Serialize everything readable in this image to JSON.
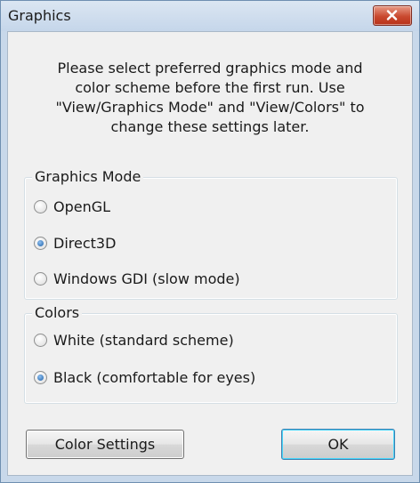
{
  "window": {
    "title": "Graphics"
  },
  "message": {
    "lines": [
      "Please select preferred graphics mode and",
      "color scheme before the first run. Use",
      "\"View/Graphics Mode\" and \"View/Colors\" to",
      "change these settings later."
    ]
  },
  "graphics_mode": {
    "legend": "Graphics Mode",
    "options": [
      {
        "label": "OpenGL",
        "checked": false
      },
      {
        "label": "Direct3D",
        "checked": true
      },
      {
        "label": "Windows GDI (slow mode)",
        "checked": false
      }
    ]
  },
  "colors": {
    "legend": "Colors",
    "options": [
      {
        "label": "White (standard scheme)",
        "checked": false
      },
      {
        "label": "Black (comfortable for eyes)",
        "checked": true
      }
    ]
  },
  "buttons": {
    "color_settings": "Color Settings",
    "ok": "OK"
  },
  "icons": {
    "close": "close-icon"
  },
  "theme": {
    "accent": "#1d5fa7",
    "close_red": "#c9492f"
  }
}
